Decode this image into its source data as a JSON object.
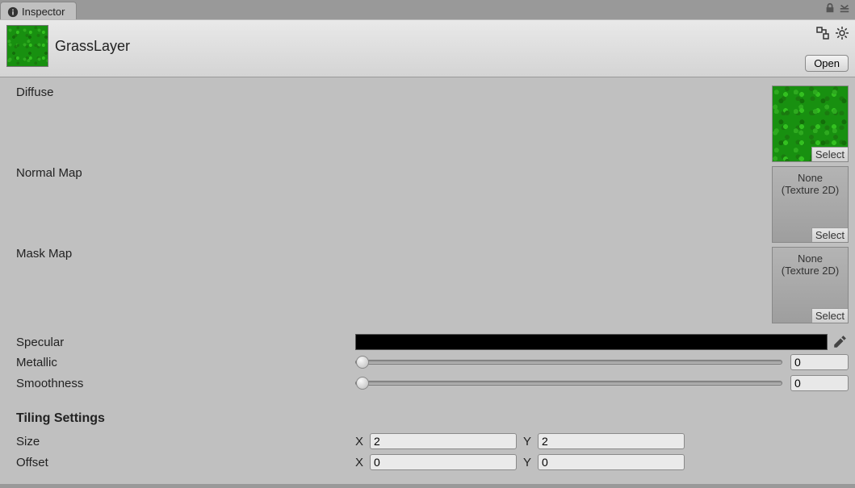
{
  "tab": {
    "title": "Inspector"
  },
  "header": {
    "asset_name": "GrassLayer",
    "open_label": "Open"
  },
  "props": {
    "diffuse": {
      "label": "Diffuse",
      "select": "Select"
    },
    "normal": {
      "label": "Normal Map",
      "none1": "None",
      "none2": "(Texture 2D)",
      "select": "Select"
    },
    "mask": {
      "label": "Mask Map",
      "none1": "None",
      "none2": "(Texture 2D)",
      "select": "Select"
    },
    "specular": {
      "label": "Specular",
      "color": "#000000"
    },
    "metallic": {
      "label": "Metallic",
      "value": "0"
    },
    "smoothness": {
      "label": "Smoothness",
      "value": "0"
    }
  },
  "tiling": {
    "header": "Tiling Settings",
    "size": {
      "label": "Size",
      "x_label": "X",
      "x": "2",
      "y_label": "Y",
      "y": "2"
    },
    "offset": {
      "label": "Offset",
      "x_label": "X",
      "x": "0",
      "y_label": "Y",
      "y": "0"
    }
  }
}
